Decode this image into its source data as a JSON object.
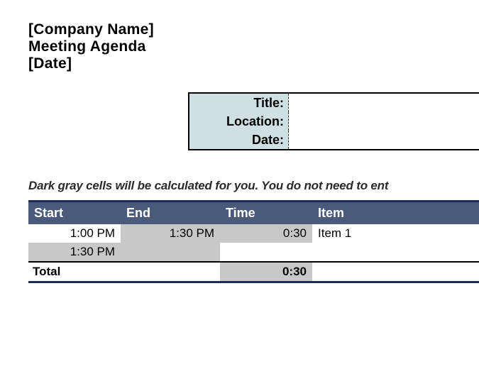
{
  "header": {
    "company_name": "[Company Name]",
    "doc_title": "Meeting Agenda",
    "date_placeholder": "[Date]"
  },
  "info": {
    "title_label": "Title:",
    "title_value": "",
    "location_label": "Location:",
    "location_value": "",
    "date_label": "Date:",
    "date_value": ""
  },
  "note": "Dark gray cells will be calculated for you. You do not need to ent",
  "agenda": {
    "columns": {
      "start": "Start",
      "end": "End",
      "time": "Time",
      "item": "Item"
    },
    "rows": [
      {
        "start": "1:00 PM",
        "end": "1:30 PM",
        "time": "0:30",
        "item": "Item 1"
      },
      {
        "start": "1:30 PM",
        "end": "",
        "time": "",
        "item": ""
      }
    ],
    "total_label": "Total",
    "total_time": "0:30"
  }
}
